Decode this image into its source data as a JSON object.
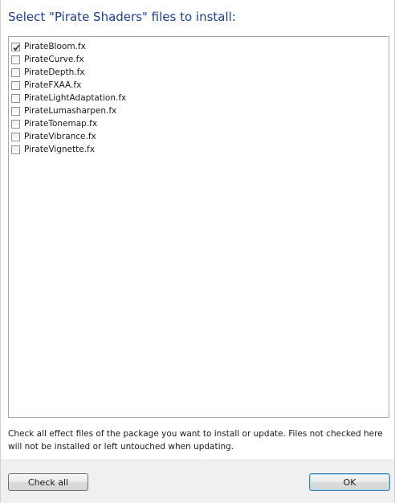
{
  "dialog": {
    "title": "Select \"Pirate Shaders\" files to install:",
    "files": [
      {
        "name": "PirateBloom.fx",
        "checked": true
      },
      {
        "name": "PirateCurve.fx",
        "checked": false
      },
      {
        "name": "PirateDepth.fx",
        "checked": false
      },
      {
        "name": "PirateFXAA.fx",
        "checked": false
      },
      {
        "name": "PirateLightAdaptation.fx",
        "checked": false
      },
      {
        "name": "PirateLumasharpen.fx",
        "checked": false
      },
      {
        "name": "PirateTonemap.fx",
        "checked": false
      },
      {
        "name": "PirateVibrance.fx",
        "checked": false
      },
      {
        "name": "PirateVignette.fx",
        "checked": false
      }
    ],
    "help_text": "Check all effect files of the package you want to install or update. Files not checked here will not be installed or left untouched when updating.",
    "check_all_label": "Check all",
    "ok_label": "OK"
  },
  "colors": {
    "title": "#1e3f8f",
    "checkmark": "#2b3a68"
  },
  "icons": {
    "checked": "checkmark-icon"
  }
}
